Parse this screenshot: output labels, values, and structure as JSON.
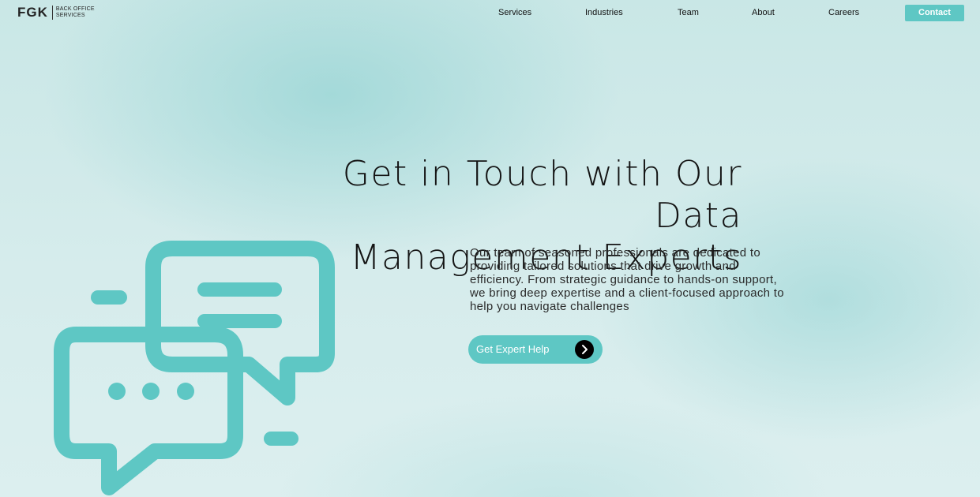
{
  "brand": {
    "mark": "FGK",
    "sub_line1": "BACK OFFICE",
    "sub_line2": "SERVICES"
  },
  "nav": {
    "links": [
      "Services",
      "Industries",
      "Team",
      "About",
      "Careers"
    ],
    "contact_label": "Contact"
  },
  "hero": {
    "headline_line1": "Get in Touch with Our Data",
    "headline_line2": "Management Experts",
    "body": "Our team of seasoned professionals are dedicated to providing tailored solutions that drive growth and efficiency. From strategic guidance to hands-on support, we bring deep expertise and a client-focused approach to help you navigate challenges",
    "cta_label": "Get Expert Help",
    "cta_icon": "chevron-right-icon",
    "illustration_icon": "chat-bubbles-icon"
  },
  "colors": {
    "accent": "#5ec7c4",
    "text": "#141414",
    "cta_arrow_bg": "#000000"
  }
}
